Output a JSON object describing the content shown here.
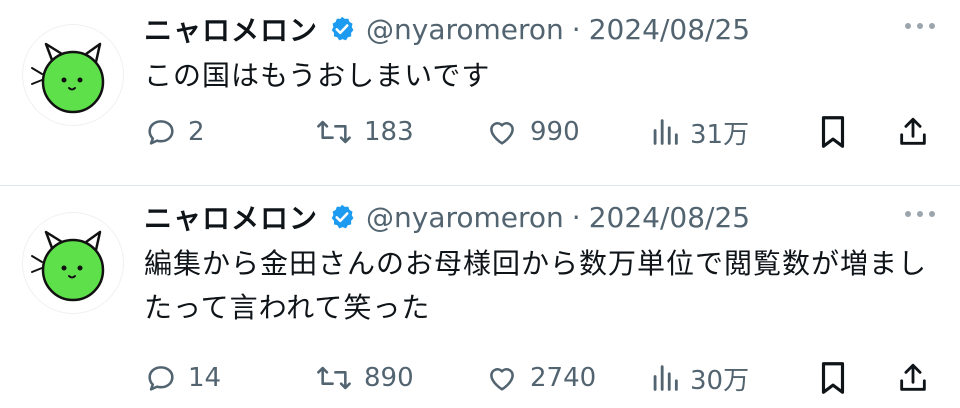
{
  "tweets": [
    {
      "author": {
        "name": "ニャロメロン",
        "handle": "@nyaromeron",
        "separator": "·",
        "date": "2024/08/25"
      },
      "text": "この国はもうおしまいです",
      "stats": {
        "replies": "2",
        "retweets": "183",
        "likes": "990",
        "views": "31万"
      }
    },
    {
      "author": {
        "name": "ニャロメロン",
        "handle": "@nyaromeron",
        "separator": "·",
        "date": "2024/08/25"
      },
      "text": "編集から金田さんのお母様回から数万単位で閲覧数が増ましたって言われて笑った",
      "stats": {
        "replies": "14",
        "retweets": "890",
        "likes": "2740",
        "views": "30万"
      }
    }
  ],
  "colors": {
    "text": "#0f1419",
    "secondary": "#536471",
    "verified": "#1d9bf0",
    "avatar_green": "#5ee04a",
    "divider": "#e1e6ea"
  },
  "icons": [
    "verified-badge-icon",
    "more-icon",
    "reply-icon",
    "retweet-icon",
    "like-icon",
    "views-icon",
    "bookmark-icon",
    "share-icon"
  ]
}
